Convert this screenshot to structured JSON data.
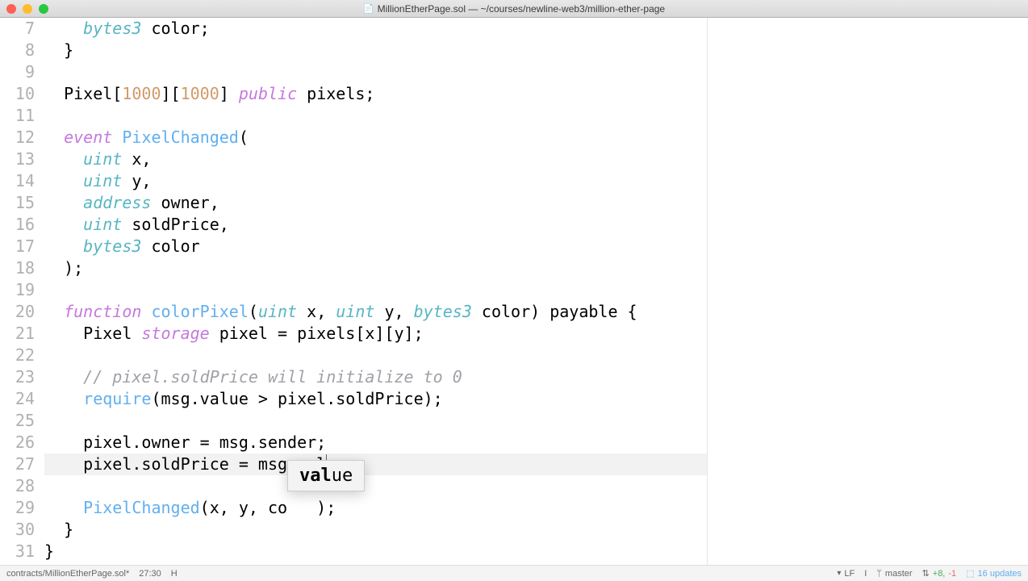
{
  "window": {
    "title": "MillionEtherPage.sol — ~/courses/newline-web3/million-ether-page"
  },
  "gutter": {
    "start": 7,
    "end": 31
  },
  "code": {
    "lines": [
      {
        "n": 7,
        "tokens": [
          {
            "t": "    ",
            "c": ""
          },
          {
            "t": "bytes3",
            "c": "typekw"
          },
          {
            "t": " color;",
            "c": ""
          }
        ]
      },
      {
        "n": 8,
        "tokens": [
          {
            "t": "  }",
            "c": ""
          }
        ]
      },
      {
        "n": 9,
        "tokens": []
      },
      {
        "n": 10,
        "tokens": [
          {
            "t": "  Pixel[",
            "c": ""
          },
          {
            "t": "1000",
            "c": "num"
          },
          {
            "t": "][",
            "c": ""
          },
          {
            "t": "1000",
            "c": "num"
          },
          {
            "t": "] ",
            "c": ""
          },
          {
            "t": "public",
            "c": "kw"
          },
          {
            "t": " pixels;",
            "c": ""
          }
        ]
      },
      {
        "n": 11,
        "tokens": []
      },
      {
        "n": 12,
        "tokens": [
          {
            "t": "  ",
            "c": ""
          },
          {
            "t": "event",
            "c": "kw"
          },
          {
            "t": " ",
            "c": ""
          },
          {
            "t": "PixelChanged",
            "c": "ident"
          },
          {
            "t": "(",
            "c": ""
          }
        ]
      },
      {
        "n": 13,
        "tokens": [
          {
            "t": "    ",
            "c": ""
          },
          {
            "t": "uint",
            "c": "typekw"
          },
          {
            "t": " x,",
            "c": ""
          }
        ]
      },
      {
        "n": 14,
        "tokens": [
          {
            "t": "    ",
            "c": ""
          },
          {
            "t": "uint",
            "c": "typekw"
          },
          {
            "t": " y,",
            "c": ""
          }
        ]
      },
      {
        "n": 15,
        "tokens": [
          {
            "t": "    ",
            "c": ""
          },
          {
            "t": "address",
            "c": "typekw"
          },
          {
            "t": " owner,",
            "c": ""
          }
        ]
      },
      {
        "n": 16,
        "tokens": [
          {
            "t": "    ",
            "c": ""
          },
          {
            "t": "uint",
            "c": "typekw"
          },
          {
            "t": " soldPrice,",
            "c": ""
          }
        ]
      },
      {
        "n": 17,
        "tokens": [
          {
            "t": "    ",
            "c": ""
          },
          {
            "t": "bytes3",
            "c": "typekw"
          },
          {
            "t": " color",
            "c": ""
          }
        ]
      },
      {
        "n": 18,
        "tokens": [
          {
            "t": "  );",
            "c": ""
          }
        ]
      },
      {
        "n": 19,
        "tokens": []
      },
      {
        "n": 20,
        "tokens": [
          {
            "t": "  ",
            "c": ""
          },
          {
            "t": "function",
            "c": "kw"
          },
          {
            "t": " ",
            "c": ""
          },
          {
            "t": "colorPixel",
            "c": "fn"
          },
          {
            "t": "(",
            "c": ""
          },
          {
            "t": "uint",
            "c": "typekw"
          },
          {
            "t": " x, ",
            "c": ""
          },
          {
            "t": "uint",
            "c": "typekw"
          },
          {
            "t": " y, ",
            "c": ""
          },
          {
            "t": "bytes3",
            "c": "typekw"
          },
          {
            "t": " color) ",
            "c": ""
          },
          {
            "t": "payable",
            "c": ""
          },
          {
            "t": " {",
            "c": ""
          }
        ]
      },
      {
        "n": 21,
        "tokens": [
          {
            "t": "    Pixel ",
            "c": ""
          },
          {
            "t": "storage",
            "c": "kw"
          },
          {
            "t": " pixel = pixels[x][y];",
            "c": ""
          }
        ]
      },
      {
        "n": 22,
        "tokens": []
      },
      {
        "n": 23,
        "tokens": [
          {
            "t": "    ",
            "c": ""
          },
          {
            "t": "// pixel.soldPrice will initialize to 0",
            "c": "cmt"
          }
        ]
      },
      {
        "n": 24,
        "tokens": [
          {
            "t": "    ",
            "c": ""
          },
          {
            "t": "require",
            "c": "fn"
          },
          {
            "t": "(msg.value > pixel.soldPrice);",
            "c": ""
          }
        ]
      },
      {
        "n": 25,
        "tokens": []
      },
      {
        "n": 26,
        "tokens": [
          {
            "t": "    pixel.owner = msg.sender;",
            "c": ""
          }
        ]
      },
      {
        "n": 27,
        "current": true,
        "tokens": [
          {
            "t": "    pixel.soldPrice = msg.val",
            "c": ""
          }
        ],
        "cursor": true
      },
      {
        "n": 28,
        "tokens": []
      },
      {
        "n": 29,
        "tokens": [
          {
            "t": "    ",
            "c": ""
          },
          {
            "t": "PixelChanged",
            "c": "fn"
          },
          {
            "t": "(x, y, co   );",
            "c": ""
          }
        ]
      },
      {
        "n": 30,
        "tokens": [
          {
            "t": "  }",
            "c": ""
          }
        ]
      },
      {
        "n": 31,
        "tokens": [
          {
            "t": "}",
            "c": ""
          }
        ]
      }
    ]
  },
  "autocomplete": {
    "match": "val",
    "rest": "ue"
  },
  "statusbar": {
    "path": "contracts/MillionEtherPage.sol*",
    "pos": "27:30",
    "mode": "H",
    "lineEnding": "LF",
    "encoding": "I",
    "branch": "master",
    "diff_plus": "+8,",
    "diff_minus": "-1",
    "updates": "16 updates"
  }
}
